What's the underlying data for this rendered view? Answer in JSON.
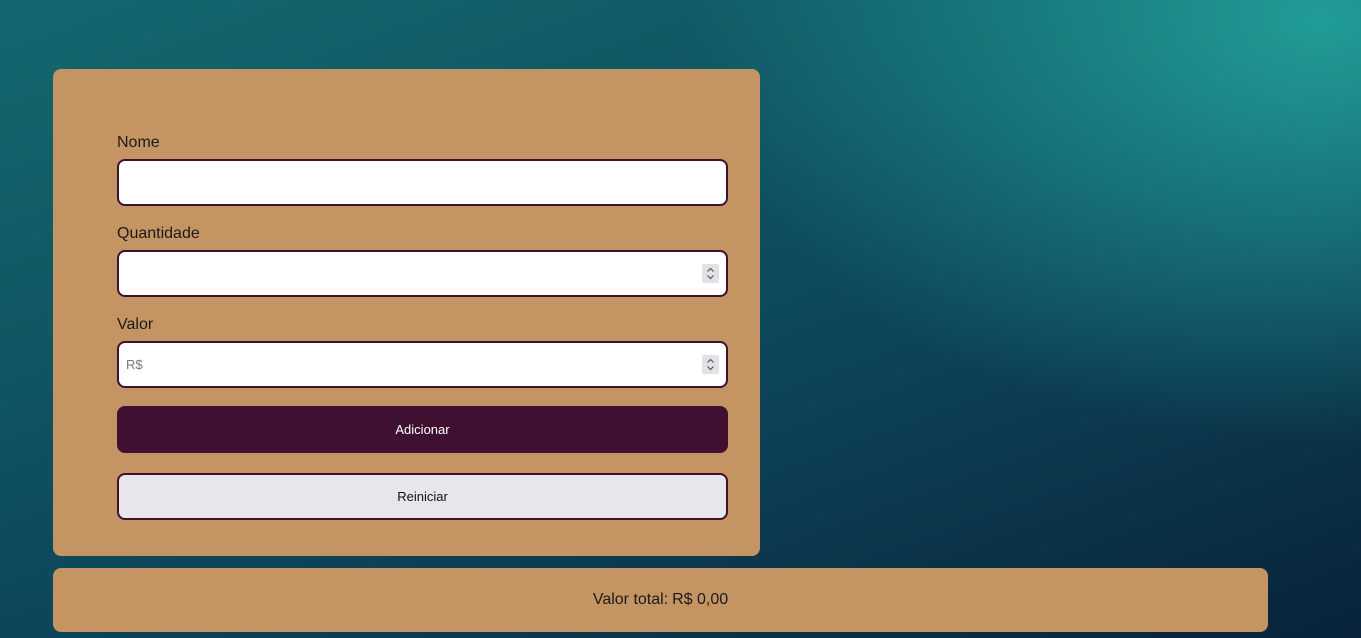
{
  "form": {
    "fields": [
      {
        "label": "Nome",
        "value": "",
        "placeholder": ""
      },
      {
        "label": "Quantidade",
        "value": "",
        "placeholder": ""
      },
      {
        "label": "Valor",
        "value": "",
        "placeholder": "R$"
      }
    ],
    "add_button_label": "Adicionar",
    "reset_button_label": "Reiniciar"
  },
  "total": {
    "label": "Valor total:",
    "value": "R$ 0,00"
  },
  "colors": {
    "card": "#c49563",
    "accent": "#3f1030",
    "reset_bg": "#e8e6ea",
    "bg_top": "#219c97",
    "bg_bottom": "#08233b"
  },
  "icons": {
    "spinner": "up-down-chevron-icon"
  }
}
